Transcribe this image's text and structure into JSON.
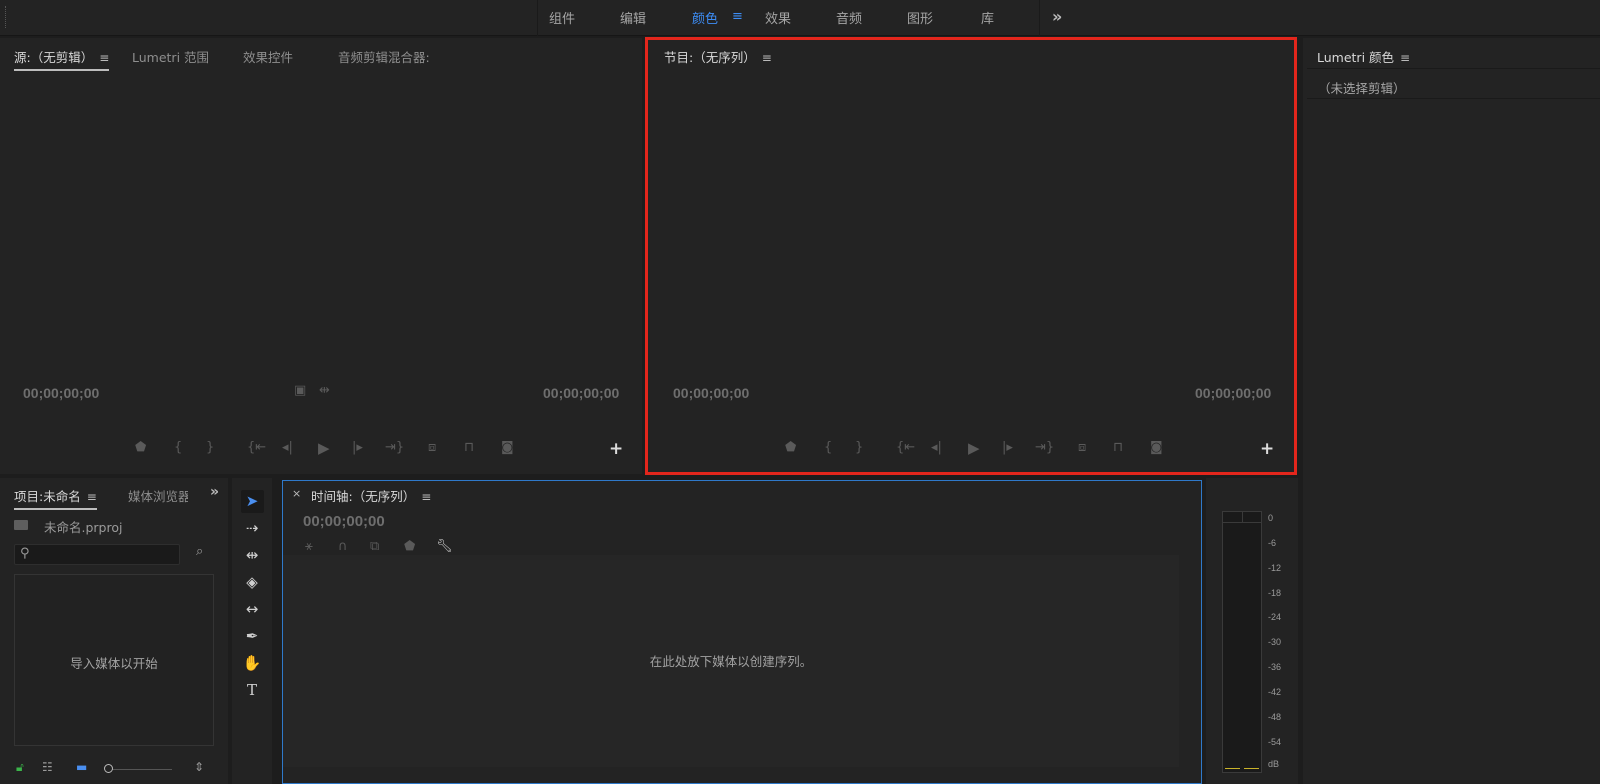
{
  "workspaces": {
    "tabs": [
      {
        "label": "组件"
      },
      {
        "label": "编辑"
      },
      {
        "label": "颜色",
        "active": true
      },
      {
        "label": "效果"
      },
      {
        "label": "音频"
      },
      {
        "label": "图形"
      },
      {
        "label": "库"
      }
    ],
    "more": "»"
  },
  "source_panel": {
    "tabs": [
      "源:（无剪辑）",
      "Lumetri 范围",
      "效果控件",
      "音频剪辑混合器:"
    ],
    "timecode_left": "00;00;00;00",
    "timecode_right": "00;00;00;00",
    "add": "+"
  },
  "program_panel": {
    "title": "节目:（无序列）",
    "timecode_left": "00;00;00;00",
    "timecode_right": "00;00;00;00",
    "add": "+"
  },
  "lumetri_panel": {
    "title": "Lumetri 颜色",
    "no_clip": "（未选择剪辑）"
  },
  "project_panel": {
    "tabs": [
      "项目:未命名",
      "媒体浏览器"
    ],
    "file": "未命名.prproj",
    "drop_hint": "导入媒体以开始"
  },
  "timeline_panel": {
    "close": "×",
    "title": "时间轴:（无序列）",
    "timecode": "00;00;00;00",
    "drop_hint": "在此处放下媒体以创建序列。"
  },
  "audio_meter": {
    "scale": [
      "0",
      "-6",
      "-12",
      "-18",
      "-24",
      "-30",
      "-36",
      "-42",
      "-48",
      "-54",
      "dB"
    ],
    "level_color": "#c9b32a"
  },
  "colors": {
    "accent": "#3d8df5",
    "highlight_outline": "#e3261c",
    "timeline_border": "#2f79c9",
    "lock_green": "#3bb54a"
  },
  "menu_glyph": "≡"
}
